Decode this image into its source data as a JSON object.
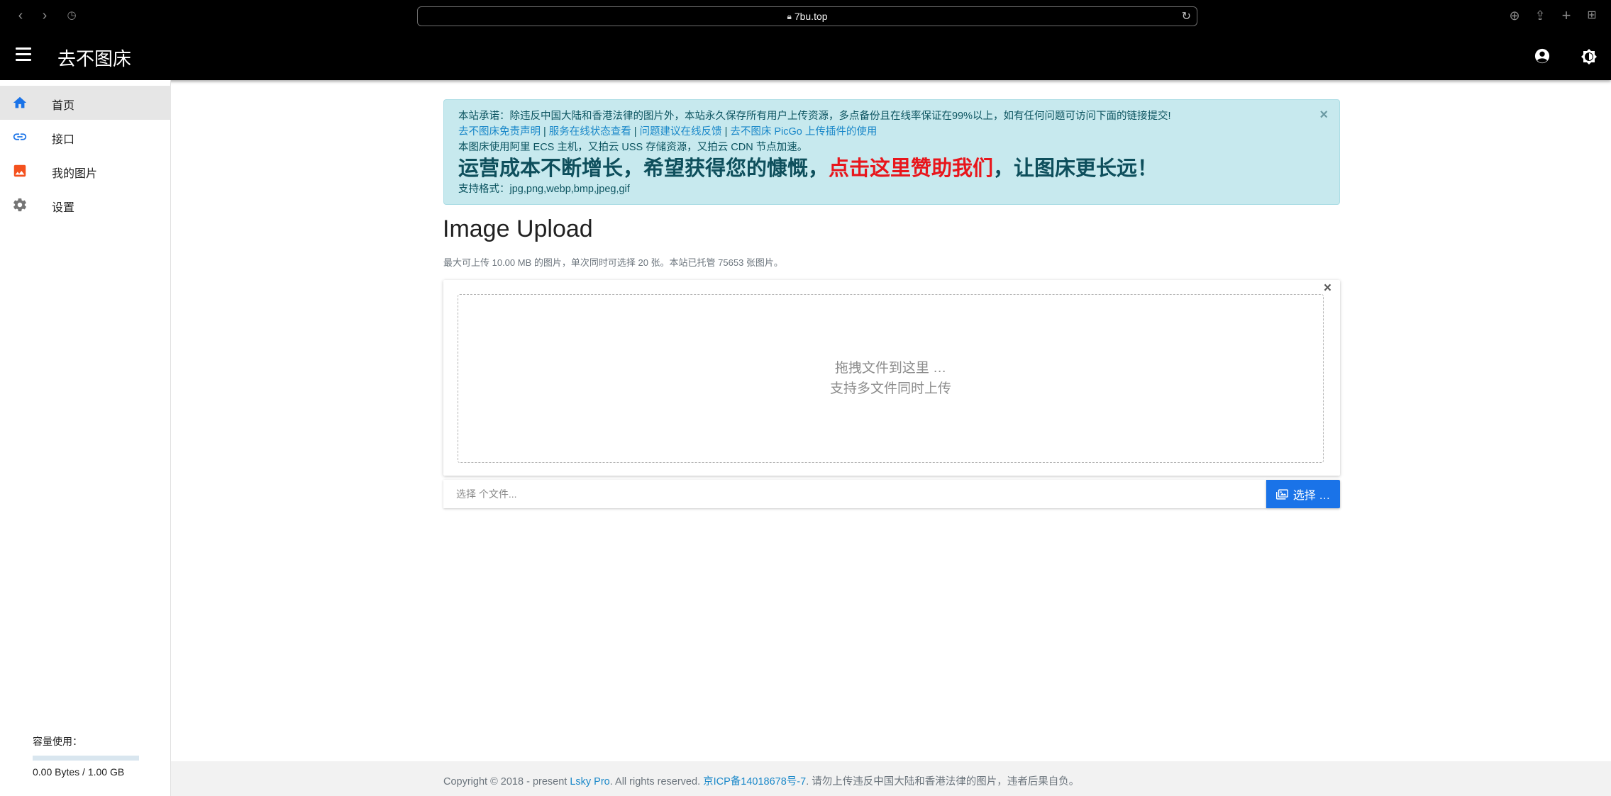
{
  "browser": {
    "url": "7bu.top"
  },
  "app": {
    "title": "去不图床"
  },
  "sidebar": {
    "items": [
      {
        "label": "首页",
        "icon": "home-icon",
        "active": true
      },
      {
        "label": "接口",
        "icon": "link-icon",
        "active": false
      },
      {
        "label": "我的图片",
        "icon": "image-icon",
        "active": false
      },
      {
        "label": "设置",
        "icon": "gear-icon",
        "active": false
      }
    ],
    "usage": {
      "title": "容量使用：",
      "value": "0.00 Bytes / 1.00 GB",
      "fraction": 0.0
    }
  },
  "notice": {
    "line1": "本站承诺：除违反中国大陆和香港法律的图片外，本站永久保存所有用户上传资源，多点备份且在线率保证在99%以上，如有任何问题可访问下面的链接提交!",
    "links": [
      "去不图床免责声明",
      "服务在线状态查看",
      "问题建议在线反馈",
      "去不图床 PicGo 上传插件的使用"
    ],
    "separator": "|",
    "line3": "本图床使用阿里 ECS 主机，又拍云 USS 存储资源，又拍云 CDN 节点加速。",
    "big_part1": "运营成本不断增长，希望获得您的慷慨，",
    "big_link": "点击这里赞助我们",
    "big_part2": "，让图床更长远！",
    "formats": "支持格式：jpg,png,webp,bmp,jpeg,gif",
    "close": "×"
  },
  "main": {
    "heading": "Image Upload",
    "note": "最大可上传 10.00 MB 的图片，单次同时可选择 20 张。本站已托管 75653 张图片。",
    "dropzone_line1": "拖拽文件到这里 …",
    "dropzone_line2": "支持多文件同时上传",
    "card_close": "×",
    "file_placeholder": "选择 个文件...",
    "choose_label": "选择 …"
  },
  "footer": {
    "prefix": "Copyright © 2018 - present ",
    "brand": "Lsky Pro",
    "middle": ". All rights reserved. ",
    "icp": "京ICP备14018678号-7",
    "suffix": ". 请勿上传违反中国大陆和香港法律的图片，违者后果自负。"
  },
  "colors": {
    "primary": "#1a73e8",
    "alert_bg": "#c7e9ee",
    "alert_text": "#0c5460",
    "highlight_red": "#e8161c"
  }
}
